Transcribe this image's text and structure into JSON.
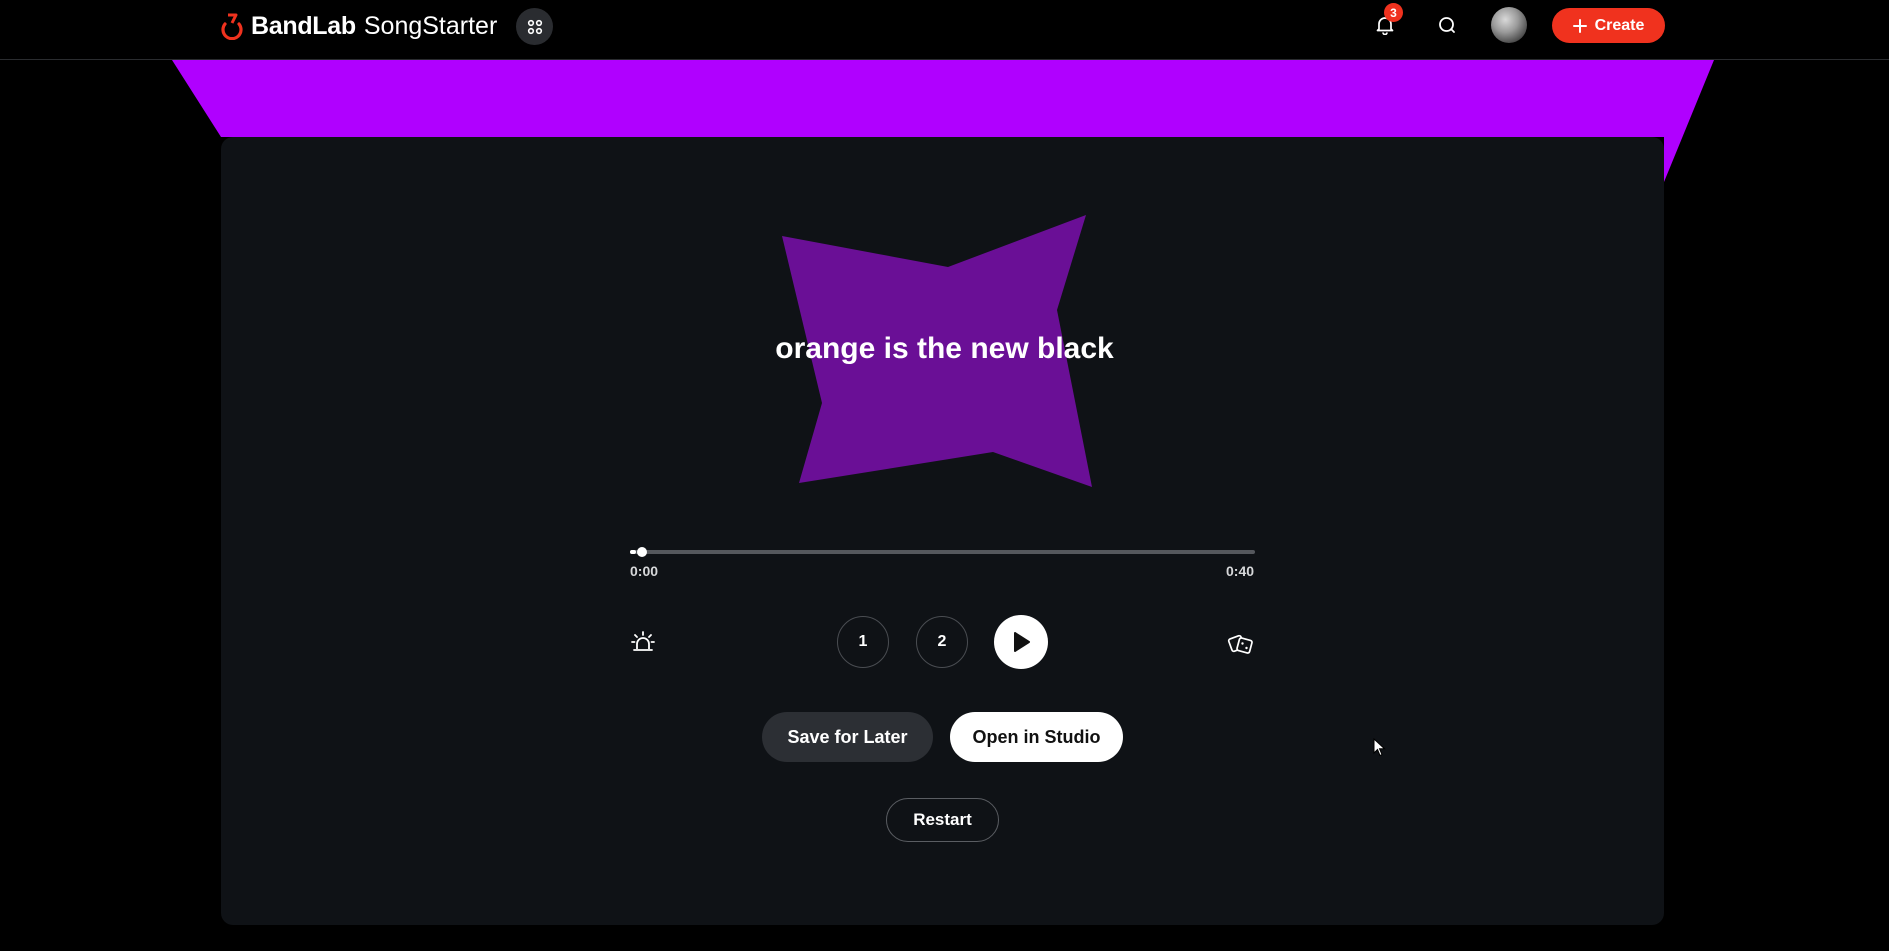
{
  "header": {
    "brand": "BandLab",
    "product": "SongStarter",
    "notification_count": "3",
    "create_label": "Create"
  },
  "song": {
    "title": "orange is the new black",
    "accent_color": "#b000ff",
    "shape_color": "#6a0f96"
  },
  "player": {
    "current_time": "0:00",
    "duration": "0:40",
    "progress_fraction": 0.01,
    "variation_1_label": "1",
    "variation_2_label": "2"
  },
  "actions": {
    "save_label": "Save for Later",
    "open_label": "Open in Studio",
    "restart_label": "Restart"
  },
  "colors": {
    "brand_red": "#f0321e",
    "card_bg": "#0f1216",
    "banner_purple": "#b000ff"
  },
  "icons": [
    "bandlab-logo-icon",
    "apps-grid-icon",
    "bell-icon",
    "search-icon",
    "plus-icon",
    "alarm-light-icon",
    "play-icon",
    "dice-icon",
    "mouse-cursor-icon"
  ]
}
